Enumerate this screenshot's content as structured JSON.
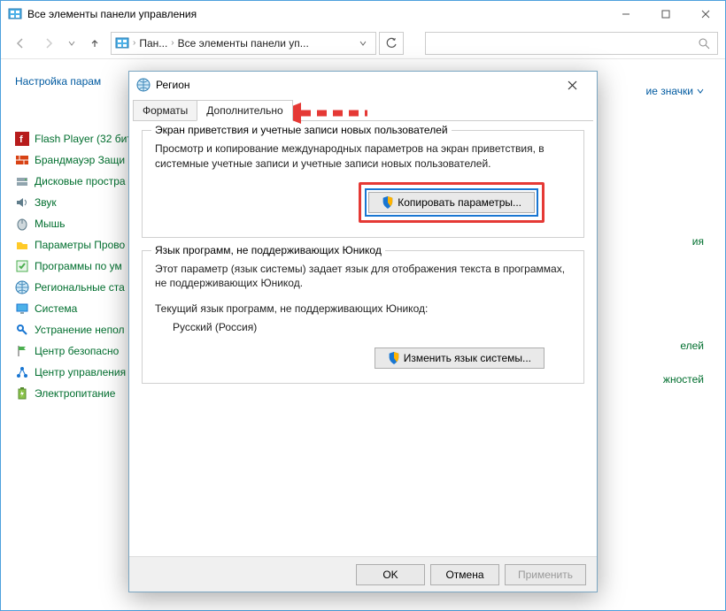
{
  "window": {
    "title": "Все элементы панели управления",
    "breadcrumb": {
      "part1": "Пан...",
      "part2": "Все элементы панели уп..."
    },
    "heading": "Настройка парам",
    "viewby_label": "ие значки",
    "items": [
      "Flash Player (32 бит",
      "Брандмауэр Защи",
      "Дисковые простра",
      "Звук",
      "Мышь",
      "Параметры Прово",
      "Программы по ум",
      "Региональные ста",
      "Система",
      "Устранение непол",
      "Центр безопасно",
      "Центр управления",
      "Электропитание"
    ],
    "right_partials": [
      "ия",
      "елей",
      "жностей"
    ]
  },
  "dialog": {
    "title": "Регион",
    "tabs": {
      "formats": "Форматы",
      "advanced": "Дополнительно"
    },
    "group1": {
      "title": "Экран приветствия и учетные записи новых пользователей",
      "text": "Просмотр и копирование международных параметров на экран приветствия, в системные учетные записи и учетные записи новых пользователей.",
      "button": "Копировать параметры..."
    },
    "group2": {
      "title": "Язык программ, не поддерживающих Юникод",
      "text": "Этот параметр (язык системы) задает язык для отображения текста в программах, не поддерживающих Юникод.",
      "current_label": "Текущий язык программ, не поддерживающих Юникод:",
      "current_value": "Русский (Россия)",
      "button": "Изменить язык системы..."
    },
    "buttons": {
      "ok": "OK",
      "cancel": "Отмена",
      "apply": "Применить"
    }
  }
}
